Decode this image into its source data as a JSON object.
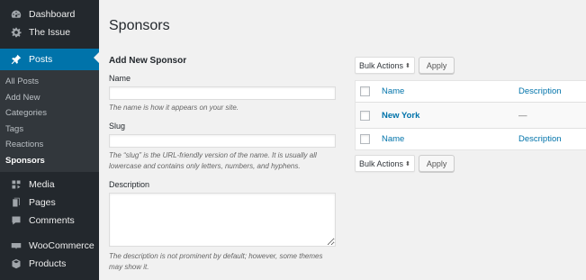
{
  "sidebar": {
    "top_items": [
      {
        "label": "Dashboard",
        "icon": "dashboard-icon"
      },
      {
        "label": "The Issue",
        "icon": "gear-icon"
      }
    ],
    "current": {
      "label": "Posts",
      "icon": "pin-icon"
    },
    "submenu": [
      "All Posts",
      "Add New",
      "Categories",
      "Tags",
      "Reactions",
      "Sponsors"
    ],
    "current_sub": "Sponsors",
    "bottom_items": [
      {
        "label": "Media",
        "icon": "media-icon"
      },
      {
        "label": "Pages",
        "icon": "pages-icon"
      },
      {
        "label": "Comments",
        "icon": "comment-icon"
      }
    ],
    "bottom_items2": [
      {
        "label": "WooCommerce",
        "icon": "woocommerce-icon"
      },
      {
        "label": "Products",
        "icon": "products-icon"
      }
    ]
  },
  "page": {
    "title": "Sponsors"
  },
  "form": {
    "heading": "Add New Sponsor",
    "name_label": "Name",
    "name_value": "",
    "name_hint": "The name is how it appears on your site.",
    "slug_label": "Slug",
    "slug_value": "",
    "slug_hint": "The “slug” is the URL-friendly version of the name. It is usually all lowercase and contains only letters, numbers, and hyphens.",
    "desc_label": "Description",
    "desc_value": "",
    "desc_hint": "The description is not prominent by default; however, some themes may show it."
  },
  "list": {
    "bulk_label": "Bulk Actions",
    "apply_label": "Apply",
    "columns": {
      "name": "Name",
      "description": "Description"
    },
    "rows": [
      {
        "name": "New York",
        "description": "—"
      }
    ]
  },
  "colors": {
    "accent": "#0073aa",
    "sidebar": "#23282d",
    "submenu": "#32373c"
  }
}
